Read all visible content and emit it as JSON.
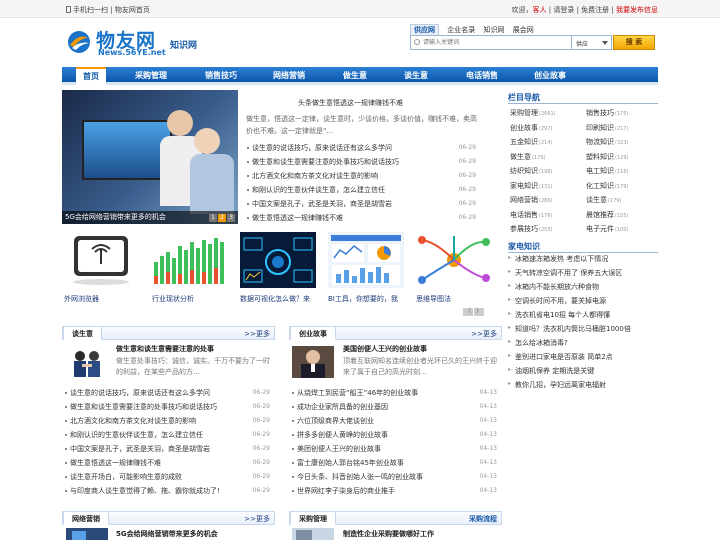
{
  "topbar": {
    "scan_label": "手机扫一扫",
    "sep": "|",
    "home_label": "物友网首页",
    "welcome": "欢迎，",
    "guest": "客人",
    "login": "请登录",
    "register": "免费注册",
    "post": "我要发布信息"
  },
  "logo": {
    "cn": "物友网",
    "en_prefix": "News.56YE.net",
    "section": "知识网"
  },
  "search": {
    "tabs": [
      "供应网",
      "企业名录",
      "知识网",
      "展会网"
    ],
    "placeholder": "请输入关键词",
    "select_value": "供应",
    "button": "搜 索"
  },
  "nav": {
    "items": [
      "首页",
      "采购管理",
      "销售技巧",
      "网络营销",
      "做生意",
      "谈生意",
      "电话销售",
      "创业故事"
    ]
  },
  "slide": {
    "caption": "5G会给网络营销带来更多的机会",
    "pages": [
      "1",
      "2",
      "3"
    ]
  },
  "headline": {
    "tag": "头条",
    "title": "做生意悟透这一规律赚钱不难",
    "summary": "做生意，悟透这一定律，谈生意时，少谈价格，多谈价值，赚钱不难，卖高价也不难。这一定律就是“..."
  },
  "top_news": [
    {
      "title": "谈生意的说话技巧，原来说话还有这么多学问",
      "date": "06-29"
    },
    {
      "title": "做生意和谈生意需要注意的处事技巧和说话技巧",
      "date": "06-29"
    },
    {
      "title": "北方酒文化和南方茶文化对谈生意的影响",
      "date": "06-29"
    },
    {
      "title": "和刚认识的生意伙伴谈生意，怎么建立信任",
      "date": "06-29"
    },
    {
      "title": "中国文案是孔子，武圣是关羽，商圣是胡雪岩",
      "date": "06-29"
    },
    {
      "title": "做生意悟透这一规律赚钱不难",
      "date": "06-29"
    }
  ],
  "thumbs": [
    {
      "label": "外网浏览器"
    },
    {
      "label": "行业现状分析"
    },
    {
      "label": "数据可视化怎么做？来"
    },
    {
      "label": "BI工具，你想要的，我"
    },
    {
      "label": "思维导图法"
    }
  ],
  "thumbs_pager": [
    "〈",
    "〉"
  ],
  "sidebar": {
    "nav_title": "栏目导航",
    "categories": [
      {
        "name": "采购管理",
        "count": "(2661)"
      },
      {
        "name": "销售技巧",
        "count": "(175)"
      },
      {
        "name": "创业故事",
        "count": "(297)"
      },
      {
        "name": "印刷知识",
        "count": "(217)"
      },
      {
        "name": "五金知识",
        "count": "(214)"
      },
      {
        "name": "物流知识",
        "count": "(323)"
      },
      {
        "name": "做生意",
        "count": "(179)"
      },
      {
        "name": "塑料知识",
        "count": "(129)"
      },
      {
        "name": "纺织知识",
        "count": "(198)"
      },
      {
        "name": "电工知识",
        "count": "(116)"
      },
      {
        "name": "家电知识",
        "count": "(131)"
      },
      {
        "name": "化工知识",
        "count": "(179)"
      },
      {
        "name": "网络营销",
        "count": "(280)"
      },
      {
        "name": "谈生意",
        "count": "(179)"
      },
      {
        "name": "电话销售",
        "count": "(176)"
      },
      {
        "name": "晨馆推荐",
        "count": "(155)"
      },
      {
        "name": "参展技巧",
        "count": "(253)"
      },
      {
        "name": "电子元件",
        "count": "(100)"
      }
    ],
    "tips_title": "家电知识",
    "tips": [
      "冰箱速冻箱发热 考虑以下情况",
      "天气转凉空调不用了 保养五大误区",
      "冰箱内不能长期放六种食物",
      "空调长时间不用，要关掉电源",
      "洗衣机省电10招 每个人都得懂",
      "知道吗？洗衣机内筒比马桶脏1000倍",
      "怎么给冰箱消毒?",
      "鉴别进口家电是否原装 简单2点",
      "油烟机保养 定期洗是关键",
      "教你几招，孕妇远离家电辐射"
    ]
  },
  "sec_tanshengyi": {
    "title": "谈生意",
    "more": ">>更多",
    "feat_title": "做生意和谈生意需要注意的处事",
    "feat_desc": "做生意处事技巧：诚信，诚实。千万不要为了一时的利益，在某些产品的方...",
    "list": [
      {
        "title": "谈生意的说话技巧，原来说话还有这么多学问",
        "date": "06-29"
      },
      {
        "title": "做生意和谈生意需要注意的处事技巧和说话技巧",
        "date": "06-29"
      },
      {
        "title": "北方酒文化和南方茶文化对谈生意的影响",
        "date": "06-29"
      },
      {
        "title": "和刚认识的生意伙伴谈生意，怎么建立信任",
        "date": "06-29"
      },
      {
        "title": "中国文案是孔子，武圣是关羽，商圣是胡雪岩",
        "date": "06-29"
      },
      {
        "title": "做生意悟透这一规律赚钱不难",
        "date": "06-29"
      },
      {
        "title": "谈生意开场白，可能影响生意的成败",
        "date": "06-29"
      },
      {
        "title": "与印度商人谈生意觉得了赖、拖、霸你就成功了!",
        "date": "06-29"
      }
    ]
  },
  "sec_chuangye": {
    "title": "创业故事",
    "more": ">>更多",
    "feat_title": "美国创便人王兴的创业故事",
    "feat_desc": "顶着互联网知名连续创业者光环已久的王兴终于迎来了属于自己的高光时刻...",
    "list": [
      {
        "title": "从烧焊工到民营“船王”46年的创业故事",
        "date": "04-13"
      },
      {
        "title": "成功企业家所具备的创业基因",
        "date": "04-13"
      },
      {
        "title": "六位顶级商界大佬谈创业",
        "date": "04-13"
      },
      {
        "title": "拼多多创便人黄峥的创业故事",
        "date": "04-13"
      },
      {
        "title": "美团创便人王兴的创业故事",
        "date": "04-13"
      },
      {
        "title": "富士康创始人郭台铭45年创业故事",
        "date": "04-13"
      },
      {
        "title": "今日头条、抖音创始人张一鸣的创业故事",
        "date": "04-13"
      },
      {
        "title": "世界网红李子柒身后的商业推手",
        "date": "04-13"
      }
    ]
  },
  "sec_wangluo": {
    "title": "网络营销",
    "more": ">>更多",
    "feat_title": "5G会给网络营销带来更多的机会"
  },
  "sec_caigou": {
    "title": "采购管理",
    "more": "采购流程",
    "feat_title": "制造性企业采购要做哪好工作"
  }
}
